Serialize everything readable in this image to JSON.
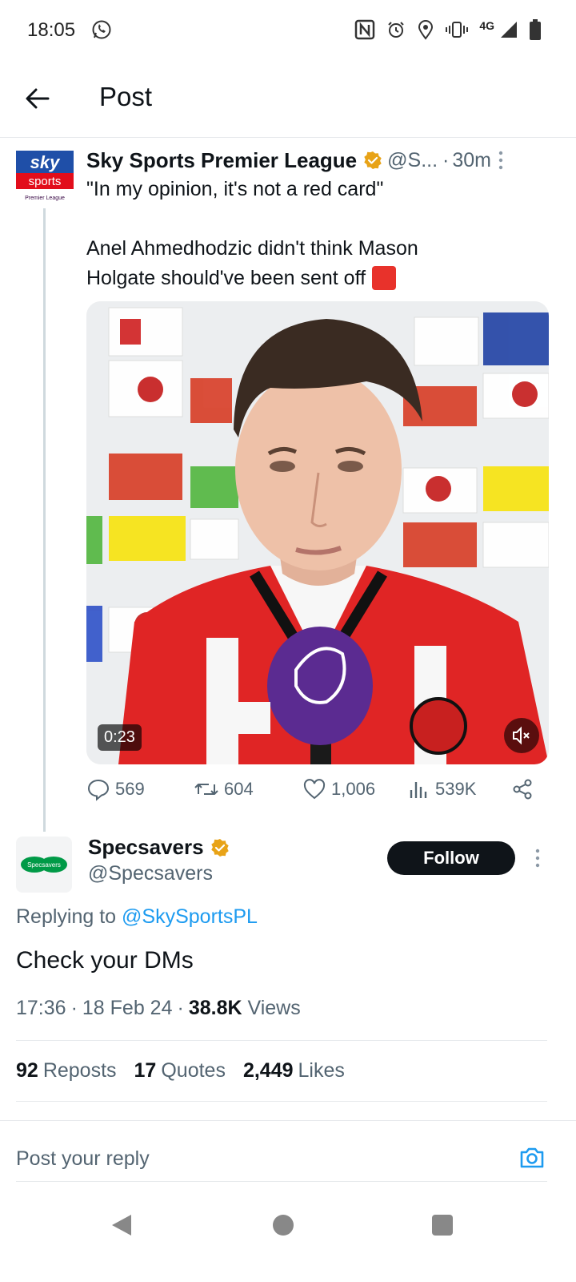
{
  "status_bar": {
    "time": "18:05",
    "network": "4G",
    "icons": [
      "whatsapp-icon",
      "nfc-icon",
      "alarm-icon",
      "location-icon",
      "vibrate-icon",
      "signal-icon",
      "battery-icon"
    ]
  },
  "header": {
    "title": "Post",
    "back_icon": "arrow-left-icon"
  },
  "parent_post": {
    "avatar_text_top": "sky",
    "avatar_text_mid": "sports",
    "avatar_text_bottom": "Premier League",
    "name": "Sky Sports Premier League",
    "handle": "@S...",
    "separator": "·",
    "time": "30m",
    "line1": "\"In my opinion, it's not a red card\"",
    "line2": "Anel Ahmedhodzic didn't think Mason",
    "line3": "Holgate should've been sent off",
    "video_duration": "0:23",
    "replies": "569",
    "reposts": "604",
    "likes": "1,006",
    "views": "539K"
  },
  "reply_post": {
    "avatar_text": "Specsavers",
    "name": "Specsavers",
    "handle": "@Specsavers",
    "follow_label": "Follow",
    "replying_prefix": "Replying to",
    "replying_handle": "@SkySportsPL",
    "body": "Check your DMs",
    "time": "17:36",
    "dot1": "·",
    "date": "18 Feb 24",
    "dot2": "·",
    "views_count": "38.8K",
    "views_label": "Views",
    "reposts_count": "92",
    "reposts_label": "Reposts",
    "quotes_count": "17",
    "quotes_label": "Quotes",
    "likes_count": "2,449",
    "likes_label": "Likes"
  },
  "composer": {
    "placeholder": "Post your reply"
  },
  "colors": {
    "accent": "#1d9bf0",
    "verified": "#e8a317",
    "text_primary": "#0f1419",
    "text_secondary": "#536471",
    "sky_blue": "#1f4fa8",
    "sky_red": "#e20d1b",
    "specsavers_green": "#009a47"
  }
}
